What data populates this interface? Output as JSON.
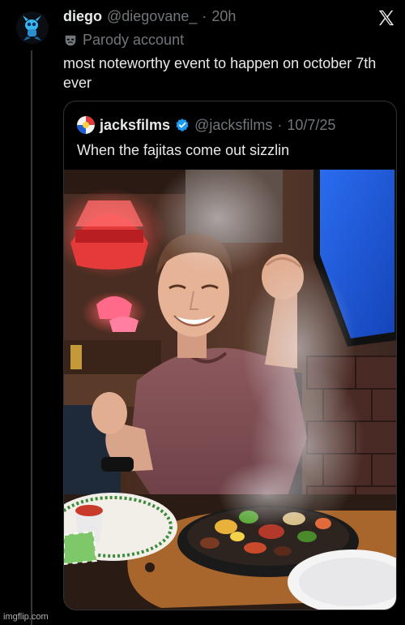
{
  "post": {
    "author_name": "diego",
    "author_handle": "@diegovane_",
    "separator": "·",
    "time": "20h",
    "label_icon": "mask-icon",
    "label": "Parody account",
    "text": "most noteworthy event to happen on october 7th ever"
  },
  "quoted_post": {
    "author_name": "jacksfilms",
    "verified_icon": "verified-badge-icon",
    "author_handle": "@jacksfilms",
    "separator": "·",
    "date": "10/7/25",
    "text": "When the fajitas come out sizzlin"
  },
  "header_icon": "x-logo-icon",
  "watermark": "imgflip.com",
  "colors": {
    "background": "#000000",
    "primary_text": "#e7e9ea",
    "secondary_text": "#71767b",
    "border": "#2f3336",
    "verified": "#1d9bf0"
  }
}
